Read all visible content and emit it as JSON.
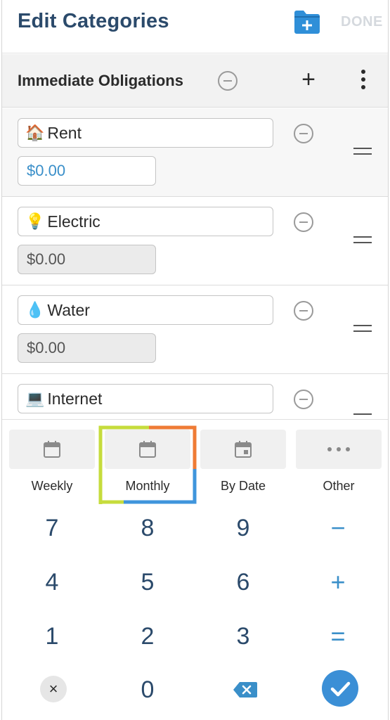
{
  "header": {
    "title": "Edit Categories",
    "done_label": "DONE",
    "folder_icon": "folder-add-icon",
    "accent_color": "#2f8fd8",
    "done_color": "#d5d9de"
  },
  "group": {
    "title": "Immediate Obligations",
    "remove_icon": "minus-circle-icon",
    "add_icon": "plus-icon",
    "add_label": "+",
    "more_icon": "more-vertical-icon"
  },
  "categories": [
    {
      "emoji": "🏠",
      "name": "Rent",
      "amount": "$0.00",
      "focused": true
    },
    {
      "emoji": "💡",
      "name": "Electric",
      "amount": "$0.00",
      "focused": false
    },
    {
      "emoji": "💧",
      "name": "Water",
      "amount": "$0.00",
      "focused": false
    },
    {
      "emoji": "💻",
      "name": "Internet",
      "amount": "",
      "focused": false
    }
  ],
  "frequency": {
    "options": [
      {
        "label": "Weekly",
        "icon": "calendar-icon"
      },
      {
        "label": "Monthly",
        "icon": "calendar-icon",
        "selected": true
      },
      {
        "label": "By Date",
        "icon": "calendar-date-icon"
      },
      {
        "label": "Other",
        "icon": "more-horizontal-icon"
      }
    ],
    "selected": "Monthly"
  },
  "keypad": {
    "rows": [
      [
        "7",
        "8",
        "9",
        "−"
      ],
      [
        "4",
        "5",
        "6",
        "+"
      ],
      [
        "1",
        "2",
        "3",
        "="
      ]
    ],
    "bottom": {
      "clear_label": "×",
      "zero_label": "0",
      "backspace_icon": "backspace-icon",
      "confirm_icon": "check-icon"
    },
    "number_color": "#2b4a6b",
    "operator_color": "#3a8fc9",
    "confirm_color": "#3b8fd6"
  }
}
